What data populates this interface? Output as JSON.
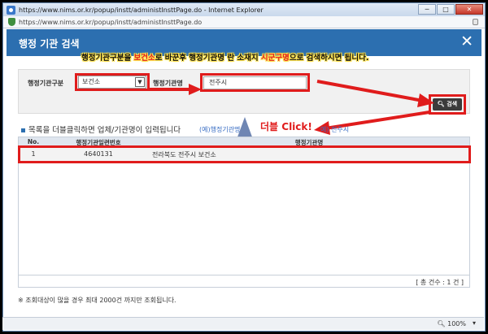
{
  "window": {
    "title": "https://www.nims.or.kr/popup/instt/administInsttPage.do - Internet Explorer",
    "address": "https://www.nims.or.kr/popup/instt/administInsttPage.do"
  },
  "modal": {
    "title": "행정 기관 검색"
  },
  "annotations": {
    "top_before": "행정기관구분을 ",
    "top_highlight1": "보건소",
    "top_middle": "로 바꾼후   행정기관명 란 소재지 ",
    "top_highlight2": "시군구명",
    "top_after": "으로 검색하시면 됩니다.",
    "double_click": "더블 Click!"
  },
  "search": {
    "type_label": "행정기관구분",
    "type_value": "보건소",
    "name_label": "행정기관명",
    "name_value": "전주시",
    "button_label": "검색"
  },
  "list": {
    "heading": "목록을 더블클릭하면 업체/기관명이 입력됩니다",
    "hint": "(예)행정기관명:",
    "hint_tail": "예) 전주시",
    "columns": [
      "No.",
      "행정기관일련번호",
      "행정기관명"
    ],
    "rows": [
      {
        "no": "1",
        "code": "4640131",
        "name": "전라북도 전주시 보건소"
      }
    ],
    "count": "[ 총 건수 : 1 건 ]"
  },
  "notice": "※ 조회대상이 많을 경우 최대 2000건 까지만 조회됩니다.",
  "status": {
    "zoom": "100%"
  },
  "colors": {
    "header": "#2c6fb0",
    "annotation_red": "#e01c1c",
    "annotation_yellow": "#ffe24a"
  }
}
